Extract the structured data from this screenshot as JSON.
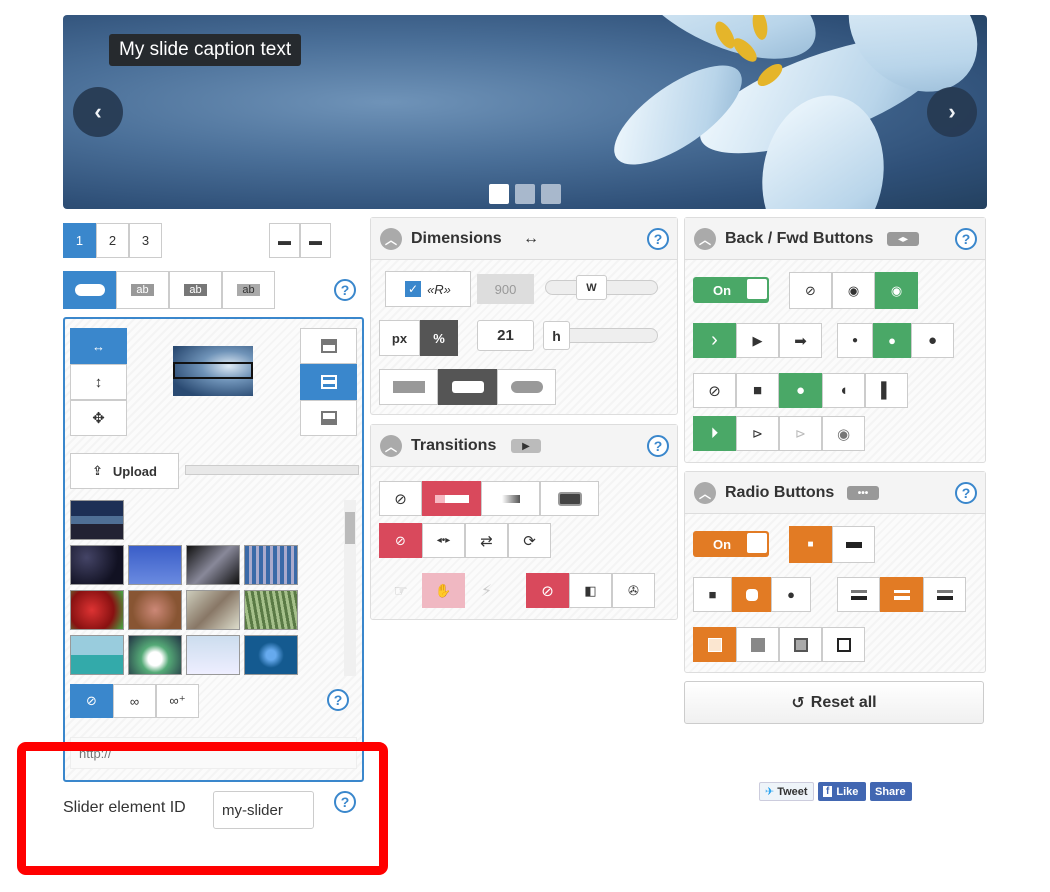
{
  "slider": {
    "caption": "My slide caption text",
    "prev_icon": "‹",
    "next_icon": "›",
    "dots": 3
  },
  "left": {
    "pages": [
      "1",
      "2",
      "3"
    ],
    "caption_styles": [
      "ab",
      "ab",
      "ab"
    ],
    "upload_label": "Upload",
    "link_icons": [
      "unlink-icon",
      "link-icon",
      "link-add-icon"
    ],
    "field_placeholder": "http://",
    "slider_id_label": "Slider element ID",
    "slider_id_value": "my-slider"
  },
  "dimensions": {
    "title": "Dimensions",
    "width_value": "900",
    "width_knob": "W",
    "unit_px": "px",
    "unit_pct": "%",
    "height_value": "21",
    "height_knob": "h"
  },
  "transitions": {
    "title": "Transitions"
  },
  "backfwd": {
    "title": "Back / Fwd Buttons",
    "toggle": "On"
  },
  "radio": {
    "title": "Radio Buttons",
    "toggle": "On"
  },
  "reset_label": "Reset all",
  "social": {
    "tweet": "Tweet",
    "like": "Like",
    "share": "Share"
  },
  "colors": {
    "blue": "#3a87cc",
    "green": "#4aa867",
    "orange": "#e27b24",
    "red": "#d9495c",
    "highlight": "#ff0000"
  }
}
